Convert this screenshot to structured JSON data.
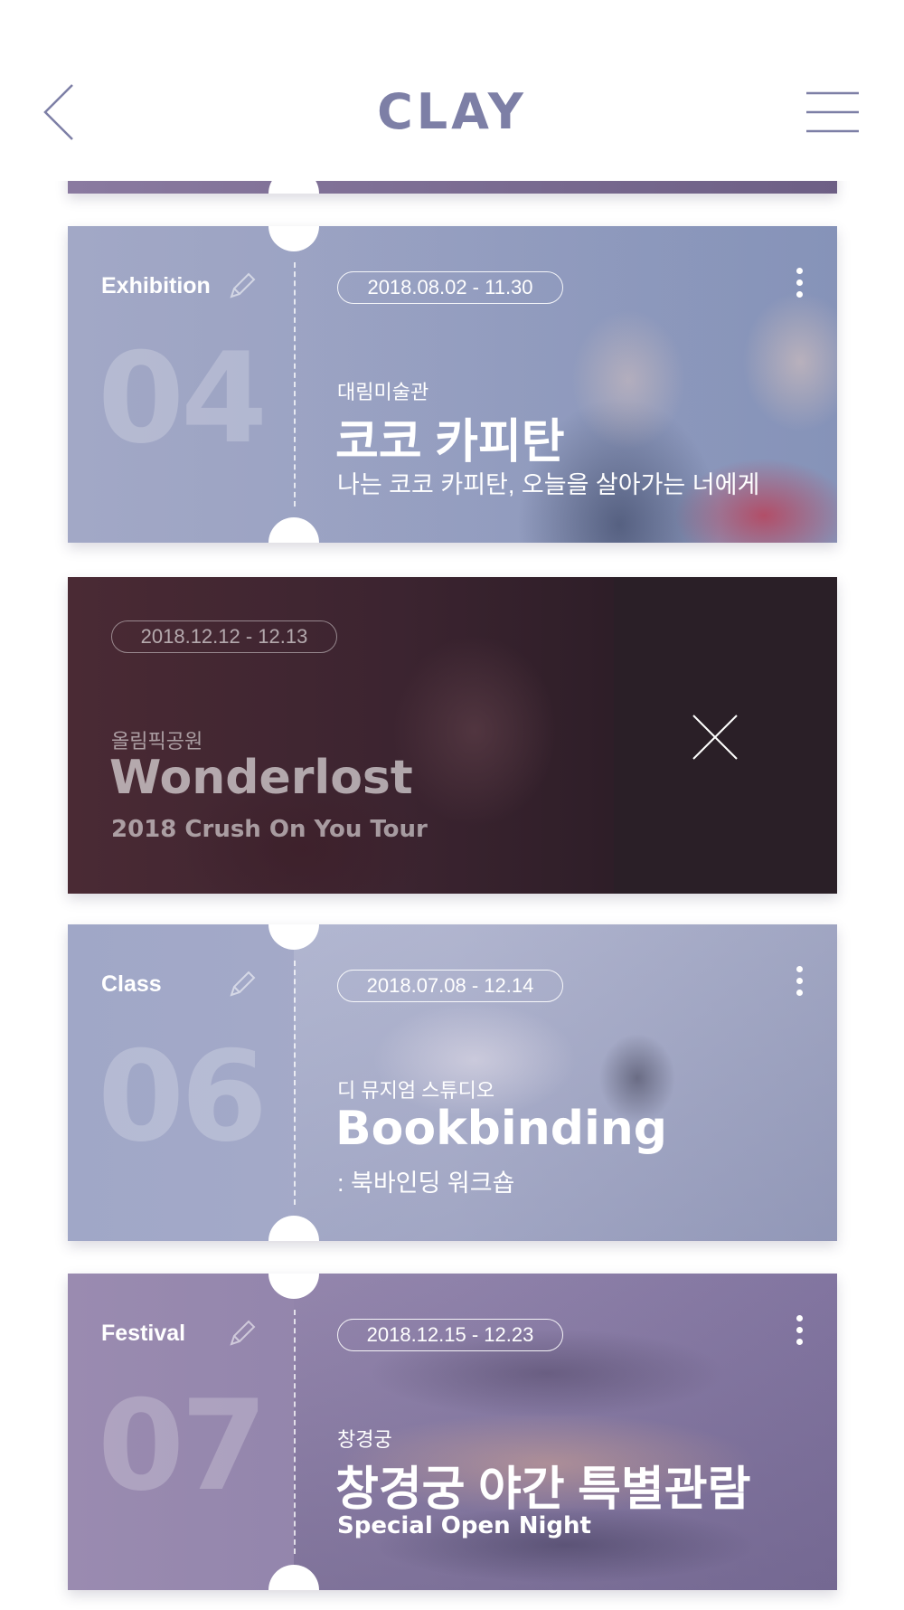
{
  "header": {
    "logo": "CLAY",
    "back_icon": "chevron-left-icon",
    "menu_icon": "hamburger-menu-icon",
    "icon_color": "#7d7fa6"
  },
  "tickets": [
    {
      "category": "Exhibition",
      "number": "04",
      "date": "2018.08.02 - 11.30",
      "venue": "대림미술관",
      "title": "코코 카피탄",
      "subtitle": "나는 코코 카피탄, 오늘을 살아가는 너에게",
      "color": "#a2a8c6"
    },
    {
      "date": "2018.12.12 - 12.13",
      "venue": "올림픽공원",
      "title": "Wonderlost",
      "subtitle": "2018 Crush On You Tour",
      "color": "#3b2530",
      "swipe_action_icon": "close-icon"
    },
    {
      "category": "Class",
      "number": "06",
      "date": "2018.07.08 - 12.14",
      "venue": "디 뮤지엄 스튜디오",
      "title": "Bookbinding",
      "subtitle": ": 북바인딩 워크숍",
      "color": "#a0a7c7"
    },
    {
      "category": "Festival",
      "number": "07",
      "date": "2018.12.15 - 12.23",
      "venue": "창경궁",
      "title": "창경궁 야간 특별관람",
      "subtitle": "Special Open Night",
      "color": "#9a8bb0"
    }
  ]
}
